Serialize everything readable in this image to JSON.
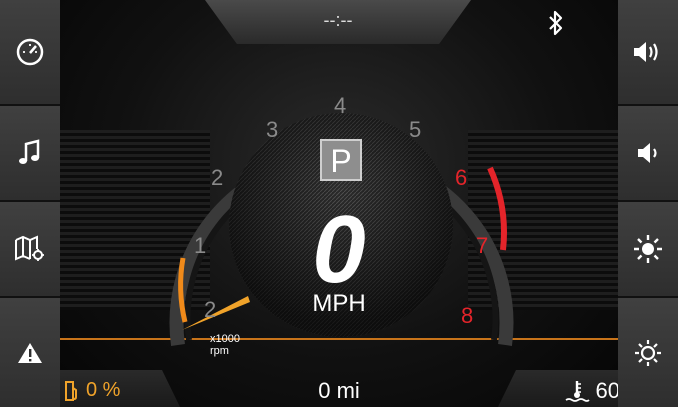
{
  "status": {
    "clock": "--:--"
  },
  "left_buttons": [
    "gauge-icon",
    "music-icon",
    "map-icon",
    "warning-icon"
  ],
  "right_buttons": [
    "volume-up-icon",
    "volume-down-icon",
    "brightness-up-icon",
    "brightness-down-icon"
  ],
  "gauge": {
    "gear": "P",
    "speed": "0",
    "speed_unit": "MPH",
    "rpm_ticks": [
      "2",
      "1",
      "2",
      "3",
      "4",
      "5",
      "6",
      "7",
      "8"
    ],
    "rpm_label_line1": "x1000",
    "rpm_label_line2": "rpm",
    "redline_from": 6,
    "rpm": 0
  },
  "bottom": {
    "fuel": "0 %",
    "odometer": "0 mi",
    "temperature": "60"
  },
  "colors": {
    "accent": "#f0a32a",
    "redline": "#e4242a"
  }
}
